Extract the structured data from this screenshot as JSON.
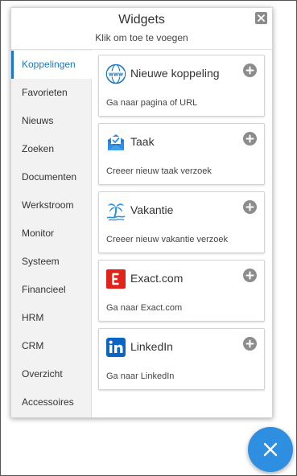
{
  "header": {
    "title": "Widgets",
    "subtitle": "Klik om toe te voegen"
  },
  "sidebar": {
    "items": [
      {
        "label": "Koppelingen",
        "active": true
      },
      {
        "label": "Favorieten"
      },
      {
        "label": "Nieuws"
      },
      {
        "label": "Zoeken"
      },
      {
        "label": "Documenten"
      },
      {
        "label": "Werkstroom"
      },
      {
        "label": "Monitor"
      },
      {
        "label": "Systeem"
      },
      {
        "label": "Financieel"
      },
      {
        "label": "HRM"
      },
      {
        "label": "CRM"
      },
      {
        "label": "Overzicht"
      },
      {
        "label": "Accessoires"
      }
    ]
  },
  "cards": [
    {
      "title": "Nieuwe koppeling",
      "description": "Ga naar pagina of URL",
      "icon": "globe-www-icon"
    },
    {
      "title": "Taak",
      "description": "Creeer nieuw taak verzoek",
      "icon": "task-envelope-icon"
    },
    {
      "title": "Vakantie",
      "description": "Creeer nieuw vakantie verzoek",
      "icon": "palm-tree-icon"
    },
    {
      "title": "Exact.com",
      "description": "Ga naar Exact.com",
      "icon": "exact-logo-icon"
    },
    {
      "title": "LinkedIn",
      "description": "Ga naar LinkedIn",
      "icon": "linkedin-logo-icon"
    }
  ],
  "colors": {
    "accent": "#1a78c2",
    "fab": "#2e8ee0",
    "exact_red": "#e2231a",
    "linkedin_blue": "#0a66c2"
  }
}
